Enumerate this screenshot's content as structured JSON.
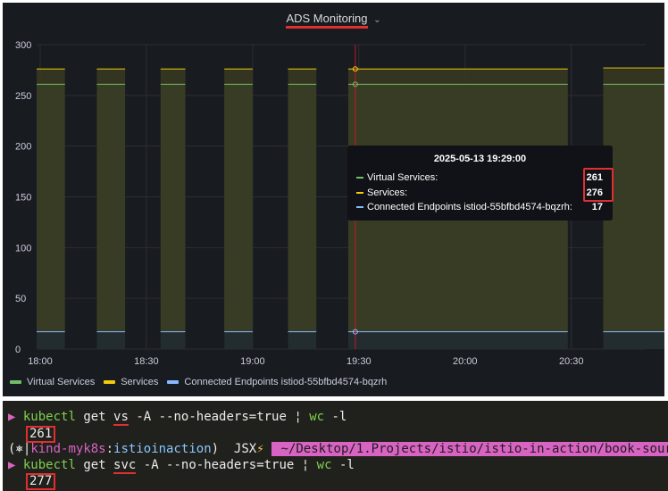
{
  "panel": {
    "title": "ADS Monitoring",
    "title_chevron": "⌄",
    "background": "#181b1f"
  },
  "chart_data": {
    "type": "area",
    "y_ticks": [
      "300",
      "250",
      "200",
      "150",
      "100",
      "50",
      "0"
    ],
    "x_ticks": [
      "18:00",
      "18:30",
      "19:00",
      "19:30",
      "20:00",
      "20:30"
    ],
    "ylim": [
      0,
      300
    ],
    "xlim": [
      "17:59",
      "20:51"
    ],
    "grid": true,
    "legend_position": "bottom-left",
    "series": [
      {
        "name": "Virtual Services",
        "color": "#73bf69",
        "value": 261
      },
      {
        "name": "Services",
        "color": "#f2cc0c",
        "value": 276,
        "last_value": 277
      },
      {
        "name": "Connected Endpoints istiod-55bfbd4574-bqzrh",
        "color": "#8ab8ff",
        "value": 17
      }
    ],
    "segments_minutes": [
      [
        0,
        8
      ],
      [
        17,
        25
      ],
      [
        35,
        42
      ],
      [
        53,
        61
      ],
      [
        71,
        79
      ],
      [
        88,
        150
      ],
      [
        160,
        178
      ]
    ],
    "cursor_time": "19:29"
  },
  "tooltip": {
    "title": "2025-05-13 19:29:00",
    "rows": [
      {
        "label": "Virtual Services:",
        "value": "261",
        "color": "#73bf69"
      },
      {
        "label": "Services:",
        "value": "276",
        "color": "#f2cc0c"
      },
      {
        "label": "Connected Endpoints istiod-55bfbd4574-bqzrh:",
        "value": "17",
        "color": "#8ab8ff"
      }
    ]
  },
  "terminal": {
    "line1": {
      "prompt": "▶",
      "cmd": "kubectl",
      "pre": " get ",
      "res": "vs",
      "post": " -A --no-headers=true ",
      "pipe": "¦",
      "cmd2": " wc",
      "post2": " -l"
    },
    "out1": "261",
    "line2": {
      "open": "(",
      "star": "⎈",
      "sep": "|",
      "ctx": "kind-myk8s",
      "colon": ":",
      "ns": "istioinaction",
      "close": ")",
      "jsx": "  JSX",
      "bolt": "⚡",
      "path": " ~/Desktop/1.Projects/istio/istio-in-action/book-sour"
    },
    "line3": {
      "prompt": "▶",
      "cmd": "kubectl",
      "pre": " get ",
      "res": "svc",
      "post": " -A --no-headers=true ",
      "pipe": "¦",
      "cmd2": " wc",
      "post2": " -l"
    },
    "out2": "277"
  }
}
